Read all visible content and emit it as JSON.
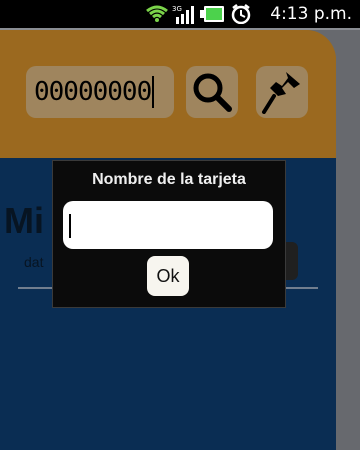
{
  "status_bar": {
    "time": "4:13 p.m.",
    "icons": [
      "wifi-icon",
      "3g-signal-icon",
      "battery-icon",
      "alarm-icon"
    ]
  },
  "app": {
    "card_number_value": "00000000",
    "search_icon": "search-icon",
    "pin_icon": "pin-icon",
    "panel_title_visible": "Mi",
    "panel_sub_visible": "dat"
  },
  "dialog": {
    "title": "Nombre de la tarjeta",
    "input_value": "",
    "ok_label": "Ok"
  },
  "colors": {
    "header_orange": "#cf8d2a",
    "panel_blue": "#0e3c6f",
    "dialog_bg": "#0b0b0b"
  }
}
